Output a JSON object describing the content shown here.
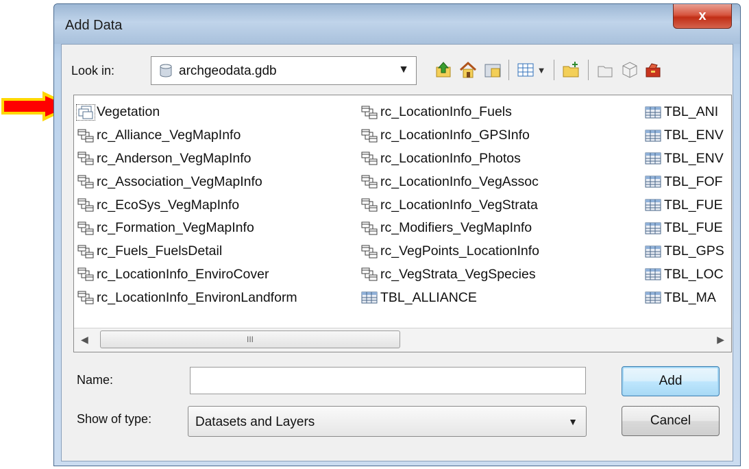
{
  "dialog": {
    "title": "Add Data",
    "close_glyph": "x"
  },
  "look_in": {
    "label": "Look in:",
    "value": "archgeodata.gdb",
    "icon": "database-icon"
  },
  "toolbar": {
    "buttons": [
      "up-one-level-icon",
      "home-icon",
      "connect-folder-icon",
      "view-menu-icon",
      "new-folder-icon",
      "new-item-icon",
      "cube-icon",
      "toolbox-icon"
    ]
  },
  "file_list": {
    "columns": [
      [
        {
          "label": "Vegetation",
          "icon": "feature-dataset-icon",
          "selected": true
        },
        {
          "label": "rc_Alliance_VegMapInfo",
          "icon": "relationship-class-icon"
        },
        {
          "label": "rc_Anderson_VegMapInfo",
          "icon": "relationship-class-icon"
        },
        {
          "label": "rc_Association_VegMapInfo",
          "icon": "relationship-class-icon"
        },
        {
          "label": "rc_EcoSys_VegMapInfo",
          "icon": "relationship-class-icon"
        },
        {
          "label": "rc_Formation_VegMapInfo",
          "icon": "relationship-class-icon"
        },
        {
          "label": "rc_Fuels_FuelsDetail",
          "icon": "relationship-class-icon"
        },
        {
          "label": "rc_LocationInfo_EnviroCover",
          "icon": "relationship-class-icon"
        },
        {
          "label": "rc_LocationInfo_EnvironLandform",
          "icon": "relationship-class-icon"
        }
      ],
      [
        {
          "label": "rc_LocationInfo_Fuels",
          "icon": "relationship-class-icon"
        },
        {
          "label": "rc_LocationInfo_GPSInfo",
          "icon": "relationship-class-icon"
        },
        {
          "label": "rc_LocationInfo_Photos",
          "icon": "relationship-class-icon"
        },
        {
          "label": "rc_LocationInfo_VegAssoc",
          "icon": "relationship-class-icon"
        },
        {
          "label": "rc_LocationInfo_VegStrata",
          "icon": "relationship-class-icon"
        },
        {
          "label": "rc_Modifiers_VegMapInfo",
          "icon": "relationship-class-icon"
        },
        {
          "label": "rc_VegPoints_LocationInfo",
          "icon": "relationship-class-icon"
        },
        {
          "label": "rc_VegStrata_VegSpecies",
          "icon": "relationship-class-icon"
        },
        {
          "label": "TBL_ALLIANCE",
          "icon": "table-icon"
        }
      ],
      [
        {
          "label": "TBL_ANI",
          "icon": "table-icon"
        },
        {
          "label": "TBL_ENV",
          "icon": "table-icon"
        },
        {
          "label": "TBL_ENV",
          "icon": "table-icon"
        },
        {
          "label": "TBL_FOF",
          "icon": "table-icon"
        },
        {
          "label": "TBL_FUE",
          "icon": "table-icon"
        },
        {
          "label": "TBL_FUE",
          "icon": "table-icon"
        },
        {
          "label": "TBL_GPS",
          "icon": "table-icon"
        },
        {
          "label": "TBL_LOC",
          "icon": "table-icon"
        },
        {
          "label": "TBL_MA",
          "icon": "table-icon"
        }
      ]
    ],
    "scroll_thumb_grip": "III"
  },
  "name_field": {
    "label": "Name:",
    "value": ""
  },
  "type_field": {
    "label": "Show of type:",
    "value": "Datasets and Layers"
  },
  "buttons": {
    "add": "Add",
    "cancel": "Cancel"
  },
  "colors": {
    "annotation_arrow": "#ff0000",
    "arrow_outline": "#ffd700"
  }
}
